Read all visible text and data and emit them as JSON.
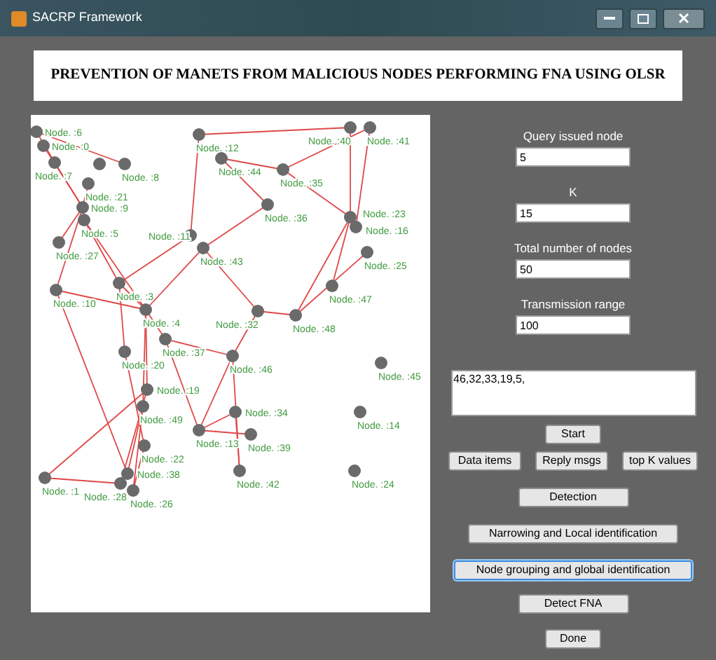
{
  "window": {
    "title": "SACRP Framework"
  },
  "heading": "PREVENTION OF MANETS FROM MALICIOUS NODES PERFORMING FNA USING OLSR",
  "nodes": [
    {
      "label": "Node. :6"
    },
    {
      "label": "Node. :0"
    },
    {
      "label": "Node. :7"
    },
    {
      "label": "Node. :8"
    },
    {
      "label": "Node. :21"
    },
    {
      "label": "Node. :9"
    },
    {
      "label": "Node. :5"
    },
    {
      "label": "Node. :27"
    },
    {
      "label": "Node. :10"
    },
    {
      "label": "Node. :3"
    },
    {
      "label": "Node. :4"
    },
    {
      "label": "Node. :37"
    },
    {
      "label": "Node. :12"
    },
    {
      "label": "Node. :44"
    },
    {
      "label": "Node. :35"
    },
    {
      "label": "Node. :36"
    },
    {
      "label": "Node. :40"
    },
    {
      "label": "Node. :41"
    },
    {
      "label": "Node. :11"
    },
    {
      "label": "Node. :43"
    },
    {
      "label": "Node. :23"
    },
    {
      "label": "Node. :16"
    },
    {
      "label": "Node. :25"
    },
    {
      "label": "Node. :47"
    },
    {
      "label": "Node. :32"
    },
    {
      "label": "Node. :48"
    },
    {
      "label": "Node. :20"
    },
    {
      "label": "Node. :46"
    },
    {
      "label": "Node. :45"
    },
    {
      "label": "Node. :19"
    },
    {
      "label": "Node. :49"
    },
    {
      "label": "Node. :13"
    },
    {
      "label": "Node. :34"
    },
    {
      "label": "Node. :39"
    },
    {
      "label": "Node. :14"
    },
    {
      "label": "Node. :22"
    },
    {
      "label": "Node. :1"
    },
    {
      "label": "Node. :38"
    },
    {
      "label": "Node. :28"
    },
    {
      "label": "Node. :26"
    },
    {
      "label": "Node. :42"
    },
    {
      "label": "Node. :24"
    }
  ],
  "fields": [
    {
      "label": "Query issued node",
      "value": "5"
    },
    {
      "label": "K",
      "value": "15"
    },
    {
      "label": "Total number of nodes",
      "value": "50"
    },
    {
      "label": "Transmission range",
      "value": "100"
    }
  ],
  "output": "46,32,33,19,5,",
  "buttons": [
    {
      "label": "Start",
      "focused": false
    },
    {
      "label": "Data items",
      "focused": false
    },
    {
      "label": "Reply msgs",
      "focused": false
    },
    {
      "label": "top K values",
      "focused": false
    },
    {
      "label": "Detection",
      "focused": false
    },
    {
      "label": "Narrowing and Local identification",
      "focused": false
    },
    {
      "label": "Node grouping and global identification",
      "focused": true
    },
    {
      "label": "Detect FNA",
      "focused": false
    },
    {
      "label": "Done",
      "focused": false
    }
  ]
}
